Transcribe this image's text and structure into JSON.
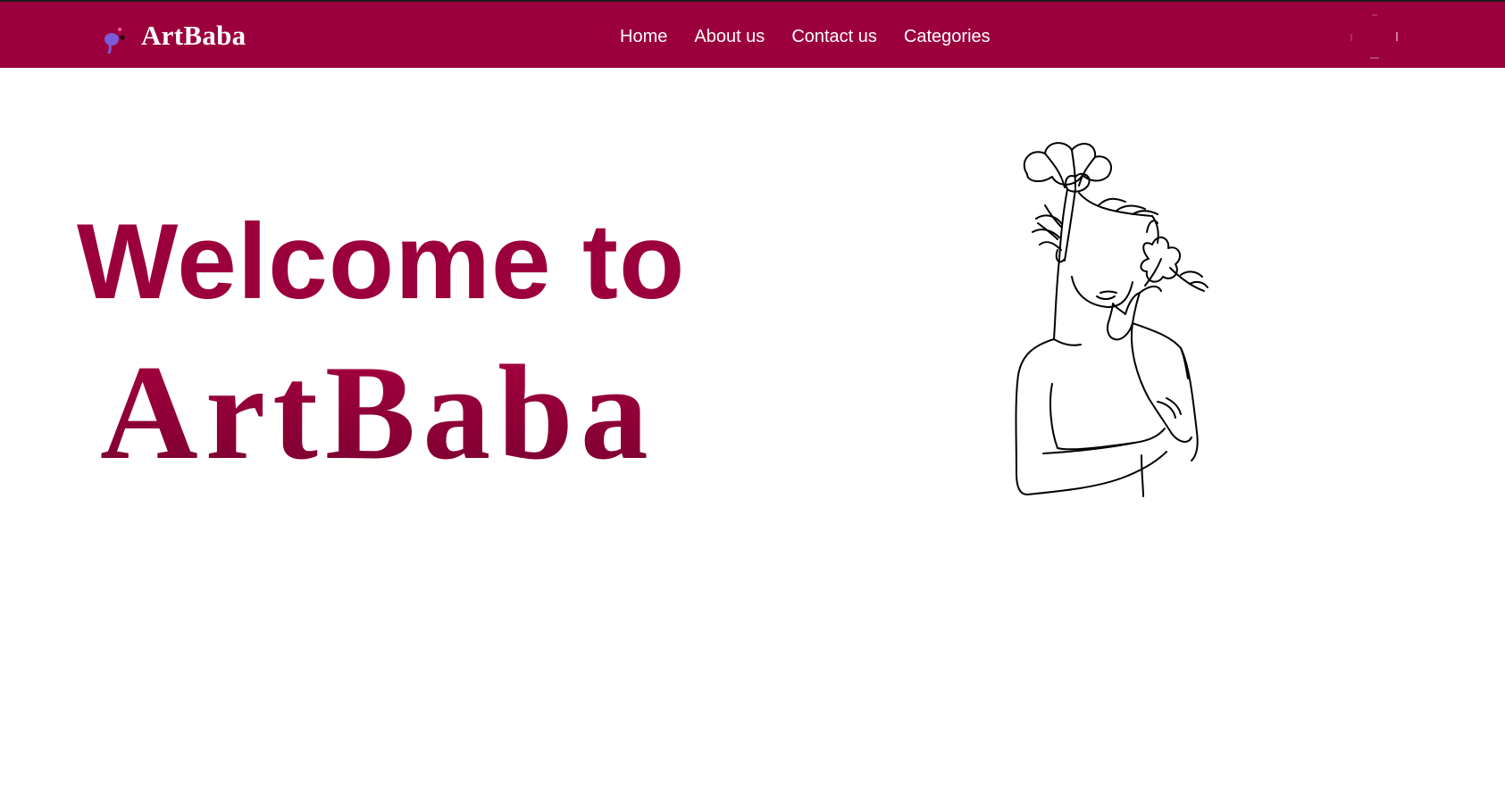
{
  "colors": {
    "brand": "#9c003c",
    "nav_text": "#ffffff",
    "page_bg": "#ffffff",
    "logo_accent": "#7b5cd6",
    "line_art": "#000000"
  },
  "navbar": {
    "brand_name": "ArtBaba",
    "brand_icon": "paint-palette-icon",
    "links": [
      {
        "label": "Home"
      },
      {
        "label": "About us"
      },
      {
        "label": "Contact us"
      },
      {
        "label": "Categories"
      }
    ],
    "toggle_icon": "menu-toggle-icon"
  },
  "hero": {
    "line1": "Welcome to",
    "line2": "ArtBaba",
    "illustration": "woman-with-flowers-line-art"
  }
}
